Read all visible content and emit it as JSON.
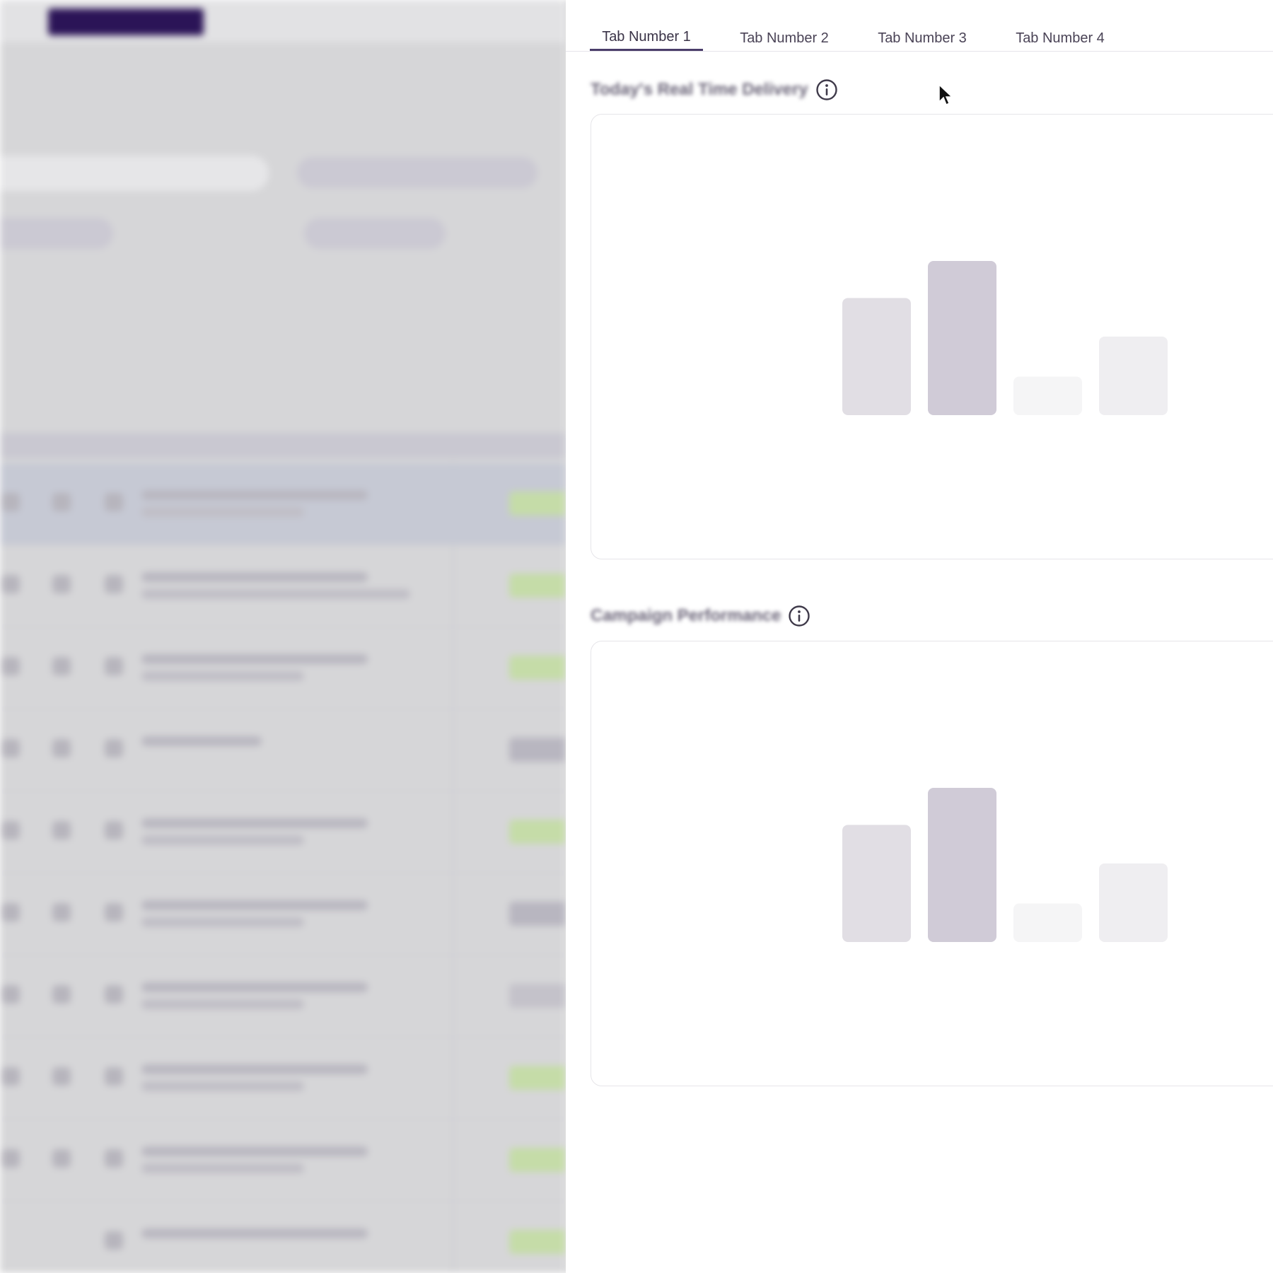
{
  "tabs": [
    {
      "label": "Tab Number 1",
      "active": true
    },
    {
      "label": "Tab Number 2",
      "active": false
    },
    {
      "label": "Tab Number 3",
      "active": false
    },
    {
      "label": "Tab Number 4",
      "active": false
    }
  ],
  "sections": [
    {
      "title": "Today's Real Time Delivery",
      "info_icon": "info-icon"
    },
    {
      "title": "Campaign Performance",
      "info_icon": "info-icon"
    }
  ],
  "placeholder_chart": {
    "type": "bar",
    "values": [
      0.76,
      1.0,
      0.25,
      0.51
    ],
    "colors": [
      "#e1dee4",
      "#d0cbd7",
      "#f5f5f6",
      "#efeef1"
    ]
  },
  "colors": {
    "tab_active_underline": "#4a3d6a",
    "background_nav_active": "#2b1457"
  }
}
